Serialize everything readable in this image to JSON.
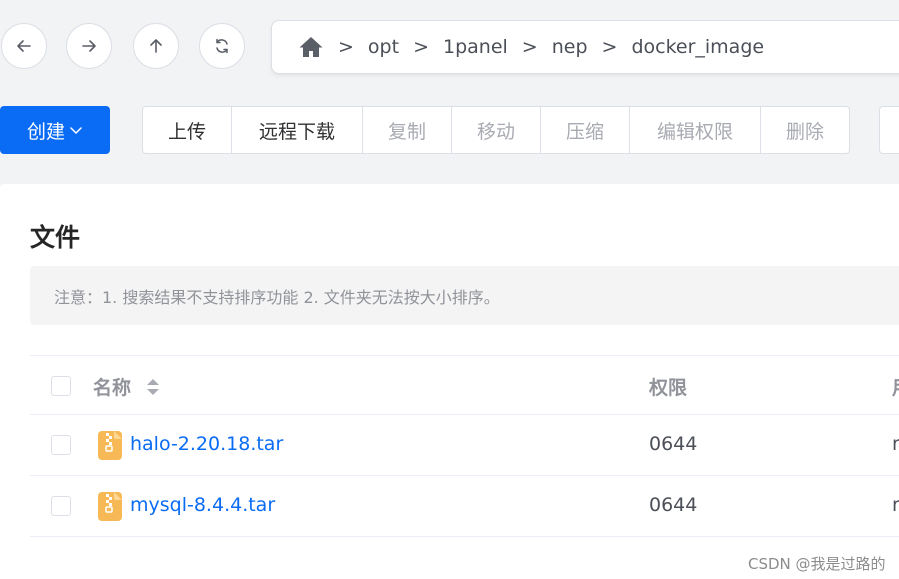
{
  "nav": {
    "back_icon": "arrow-left-icon",
    "forward_icon": "arrow-right-icon",
    "up_icon": "arrow-up-icon",
    "refresh_icon": "refresh-icon"
  },
  "breadcrumb": {
    "home_icon": "home-icon",
    "separator": ">",
    "items": [
      "opt",
      "1panel",
      "nep",
      "docker_image"
    ]
  },
  "toolbar": {
    "create_label": "创建",
    "buttons": [
      {
        "label": "上传",
        "enabled": true
      },
      {
        "label": "远程下载",
        "enabled": true
      },
      {
        "label": "复制",
        "enabled": false
      },
      {
        "label": "移动",
        "enabled": false
      },
      {
        "label": "压缩",
        "enabled": false
      },
      {
        "label": "编辑权限",
        "enabled": false
      },
      {
        "label": "删除",
        "enabled": false
      }
    ]
  },
  "main": {
    "title": "文件",
    "notice": "注意：1. 搜索结果不支持排序功能 2. 文件夹无法按大小排序。"
  },
  "table": {
    "columns": {
      "name": "名称",
      "permission": "权限",
      "next_col_partial": "用"
    },
    "rows": [
      {
        "name": "halo-2.20.18.tar",
        "permission": "0644",
        "next_partial": "r"
      },
      {
        "name": "mysql-8.4.4.tar",
        "permission": "0644",
        "next_partial": "r"
      }
    ]
  },
  "colors": {
    "primary": "#0a6cf5",
    "file_icon": "#f7b955"
  },
  "watermark": "CSDN @我是过路的"
}
